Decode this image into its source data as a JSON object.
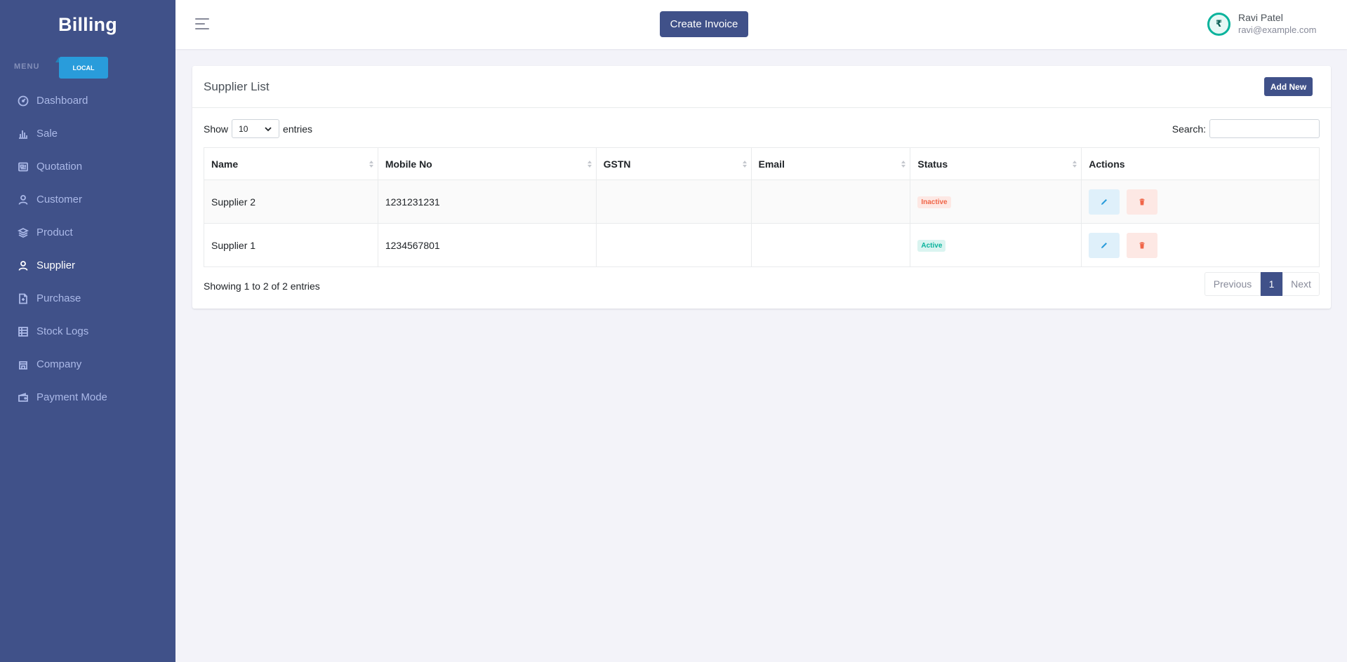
{
  "brand": "Billing",
  "menu": {
    "title": "MENU",
    "badge": "LOCAL"
  },
  "sidebar": {
    "items": [
      {
        "label": "Dashboard",
        "icon": "dashboard-icon"
      },
      {
        "label": "Sale",
        "icon": "bar-chart-icon"
      },
      {
        "label": "Quotation",
        "icon": "newspaper-icon"
      },
      {
        "label": "Customer",
        "icon": "user-icon"
      },
      {
        "label": "Product",
        "icon": "layers-icon"
      },
      {
        "label": "Supplier",
        "icon": "user-icon",
        "active": true
      },
      {
        "label": "Purchase",
        "icon": "file-icon"
      },
      {
        "label": "Stock Logs",
        "icon": "table-icon"
      },
      {
        "label": "Company",
        "icon": "building-icon"
      },
      {
        "label": "Payment Mode",
        "icon": "wallet-icon"
      }
    ]
  },
  "topbar": {
    "create_invoice": "Create Invoice",
    "user": {
      "name": "Ravi Patel",
      "email": "ravi@example.com",
      "avatar_glyph": "₹"
    }
  },
  "card": {
    "title": "Supplier List",
    "add_new": "Add New",
    "show_label": "Show",
    "entries_label": "entries",
    "page_size": "10",
    "search_label": "Search:",
    "search_value": ""
  },
  "table": {
    "headers": [
      "Name",
      "Mobile No",
      "GSTN",
      "Email",
      "Status",
      "Actions"
    ],
    "rows": [
      {
        "name": "Supplier 2",
        "mobile": "1231231231",
        "gstn": "",
        "email": "",
        "status": "Inactive"
      },
      {
        "name": "Supplier 1",
        "mobile": "1234567801",
        "gstn": "",
        "email": "",
        "status": "Active"
      }
    ]
  },
  "footer": {
    "info": "Showing 1 to 2 of 2 entries",
    "previous": "Previous",
    "page": "1",
    "next": "Next"
  },
  "colors": {
    "sidebar": "#405189",
    "accent": "#405189",
    "badge_local": "#299cdb",
    "inactive": "#f06548",
    "active": "#0ab39c"
  }
}
